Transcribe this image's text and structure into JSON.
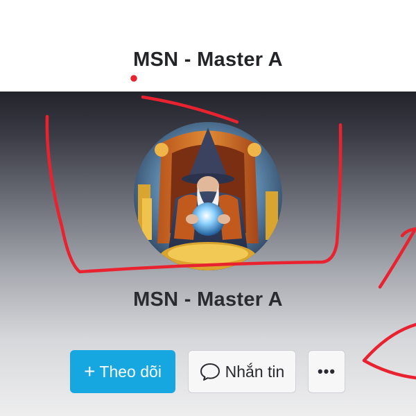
{
  "header": {
    "title": "MSN - Master A"
  },
  "profile": {
    "name": "MSN - Master A",
    "avatar_description": "wizard-with-crystal-ball-avatar"
  },
  "actions": {
    "follow_label": "Theo dõi",
    "follow_icon": "plus-icon",
    "message_label": "Nhắn tin",
    "message_icon": "chat-bubble-icon",
    "more_label": "•••"
  },
  "colors": {
    "follow_button": "#17a7e0",
    "annotation_stroke": "#e8232f",
    "title_text": "#222428"
  }
}
